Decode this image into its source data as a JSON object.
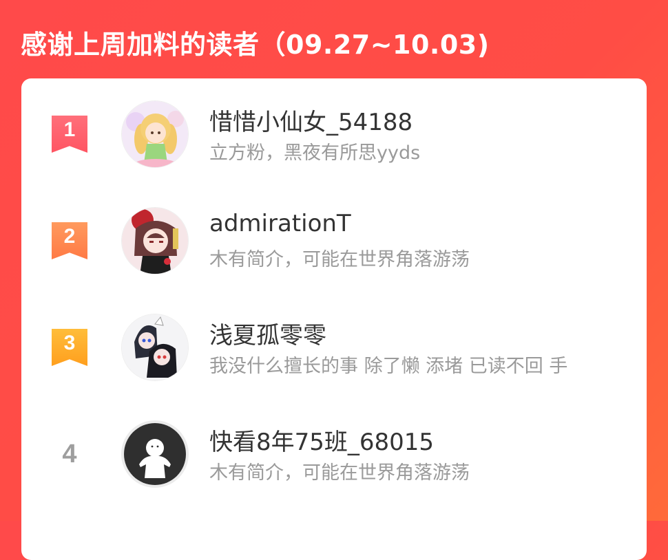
{
  "header": {
    "title": "感谢上周加料的读者（09.27~10.03)"
  },
  "colors": {
    "background_start": "#ff4a4a",
    "background_end": "#ff6a3a",
    "rank1": "#ff6070",
    "rank2": "#ff8a50",
    "rank3": "#ffae2a",
    "rank_plain": "#9e9e9e"
  },
  "readers": [
    {
      "rank": "1",
      "name": "惜惜小仙女_54188",
      "bio": "立方粉，黑夜有所思yyds",
      "avatar": "anime-girl-gold-avatar"
    },
    {
      "rank": "2",
      "name": "admirationT",
      "bio": "木有简介，可能在世界角落游荡",
      "avatar": "anime-girl-red-hair-avatar"
    },
    {
      "rank": "3",
      "name": "浅夏孤零零",
      "bio": "我没什么擅长的事 除了懒 添堵 已读不回 手",
      "avatar": "anime-duo-hooded-avatar"
    },
    {
      "rank": "4",
      "name": "快看8年75班_68015",
      "bio": "木有简介，可能在世界角落游荡",
      "avatar": "default-user-avatar"
    }
  ]
}
